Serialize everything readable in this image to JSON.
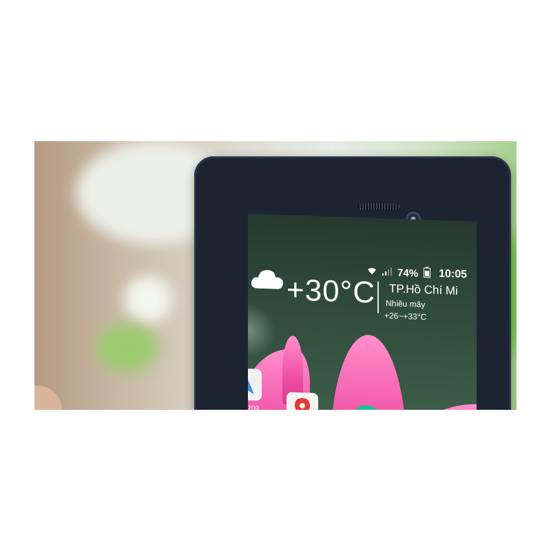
{
  "status_bar": {
    "battery_percent": "74%",
    "time": "10:05",
    "icons": [
      "wifi-icon",
      "signal-icon",
      "battery-icon"
    ]
  },
  "weather": {
    "temperature": "+30°C",
    "city": "TP.Hồ Chí Mi",
    "condition": "Nhiều mây",
    "range": "+26~+33°C",
    "icon": "cloud-icon"
  },
  "home_apps": [
    {
      "icon": "navigation-icon",
      "label": "hương"
    },
    {
      "icon": "maps-icon",
      "label": ""
    },
    {
      "icon": "phone-app-icon",
      "label": ""
    }
  ],
  "colors": {
    "wallpaper_petal": "#f04fa6",
    "screen_bg": "#2f4a3b",
    "phone_body": "#1c2432"
  }
}
